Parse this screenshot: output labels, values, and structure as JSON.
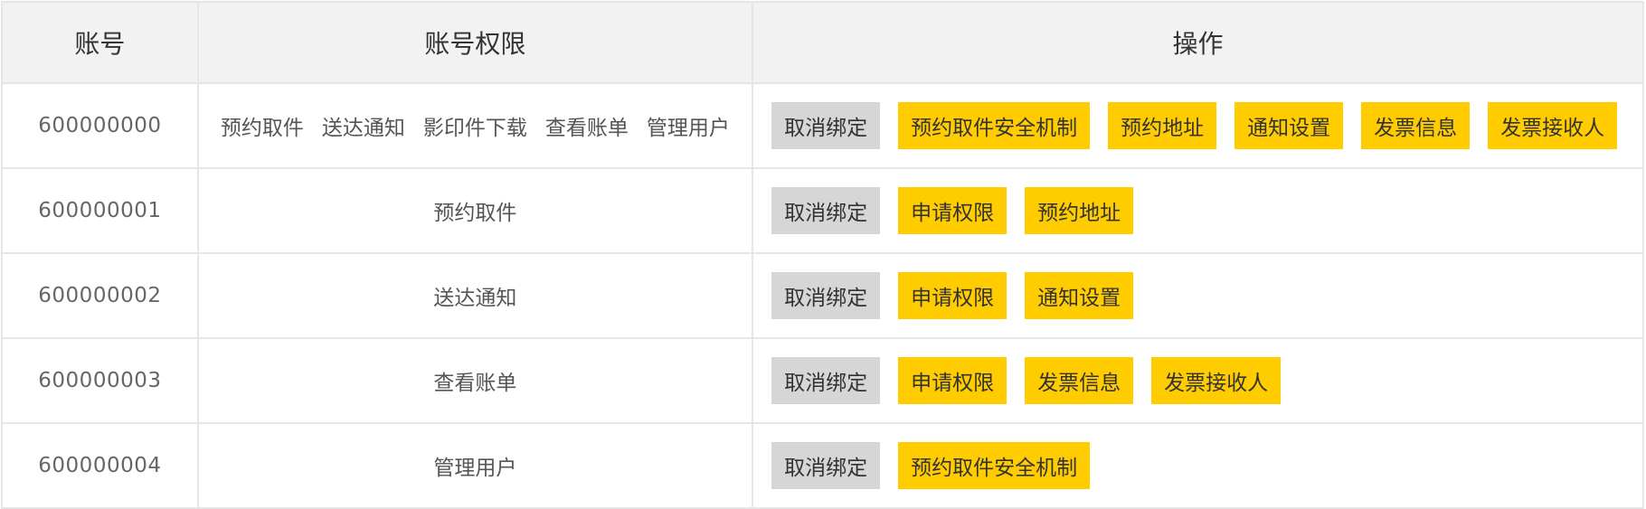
{
  "colors": {
    "header_bg": "#f2f2f2",
    "border": "#e6e6e6",
    "unbind_button": "#d6d6d6",
    "action_button": "#ffcc00"
  },
  "table": {
    "headers": [
      "账号",
      "账号权限",
      "操作"
    ],
    "rows": [
      {
        "account": "600000000",
        "permissions": [
          "预约取件",
          "送达通知",
          "影印件下载",
          "查看账单",
          "管理用户"
        ],
        "unbind": "取消绑定",
        "actions": [
          "预约取件安全机制",
          "预约地址",
          "通知设置",
          "发票信息",
          "发票接收人"
        ]
      },
      {
        "account": "600000001",
        "permissions": [
          "预约取件"
        ],
        "unbind": "取消绑定",
        "actions": [
          "申请权限",
          "预约地址"
        ]
      },
      {
        "account": "600000002",
        "permissions": [
          "送达通知"
        ],
        "unbind": "取消绑定",
        "actions": [
          "申请权限",
          "通知设置"
        ]
      },
      {
        "account": "600000003",
        "permissions": [
          "查看账单"
        ],
        "unbind": "取消绑定",
        "actions": [
          "申请权限",
          "发票信息",
          "发票接收人"
        ]
      },
      {
        "account": "600000004",
        "permissions": [
          "管理用户"
        ],
        "unbind": "取消绑定",
        "actions": [
          "预约取件安全机制"
        ]
      }
    ]
  }
}
